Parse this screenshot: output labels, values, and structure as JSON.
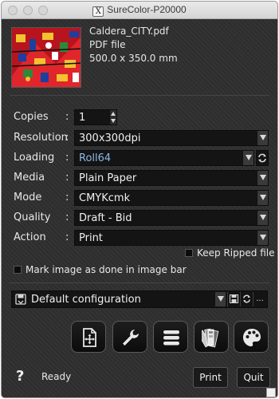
{
  "window": {
    "title": "SureColor-P20000"
  },
  "file": {
    "name": "Caldera_CITY.pdf",
    "type": "PDF file",
    "size": "500.0 x 350.0 mm"
  },
  "fields": {
    "copies": {
      "label": "Copies",
      "value": "1"
    },
    "resolution": {
      "label": "Resolution",
      "value": "300x300dpi"
    },
    "loading": {
      "label": "Loading",
      "value": "Roll64"
    },
    "media": {
      "label": "Media",
      "value": "Plain Paper"
    },
    "mode": {
      "label": "Mode",
      "value": "CMYKcmk"
    },
    "quality": {
      "label": "Quality",
      "value": "Draft - Bid"
    },
    "action": {
      "label": "Action",
      "value": "Print"
    }
  },
  "colon": ":",
  "keep_ripped": {
    "label": "Keep Ripped file",
    "checked": false
  },
  "mark_image": {
    "label": "Mark image as done in image bar",
    "checked": false
  },
  "config": {
    "value": "Default configuration",
    "more": "..."
  },
  "toolbar": {
    "items": [
      "layout-icon",
      "wrench-icon",
      "list-icon",
      "swatch-icon",
      "palette-icon"
    ]
  },
  "footer": {
    "help": "?",
    "status": "Ready",
    "print_label": "Print",
    "quit_label": "Quit"
  },
  "colors": {
    "accent_text": "#8db8e8",
    "background": "#2f2f2f",
    "field": "#141414"
  }
}
